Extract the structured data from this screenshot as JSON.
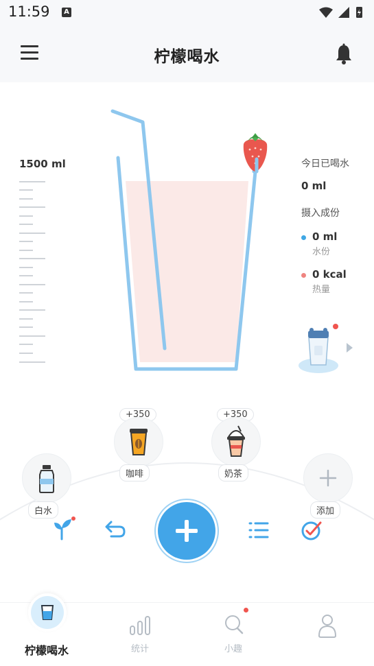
{
  "status_bar": {
    "time": "11:59"
  },
  "header": {
    "title": "柠檬喝水"
  },
  "goal": {
    "label": "1500 ml"
  },
  "today": {
    "title": "今日已喝水",
    "value": "0 ml",
    "intake_title": "摄入成份",
    "water_value": "0 ml",
    "water_label": "水份",
    "calorie_value": "0 kcal",
    "calorie_label": "热量"
  },
  "drinks": [
    {
      "label": "白水",
      "bonus": ""
    },
    {
      "label": "咖啡",
      "bonus": "+350"
    },
    {
      "label": "奶茶",
      "bonus": "+350"
    },
    {
      "label": "添加",
      "bonus": ""
    }
  ],
  "nav": [
    {
      "label": "柠檬喝水"
    },
    {
      "label": "统计"
    },
    {
      "label": "小趣"
    },
    {
      "label": ""
    }
  ],
  "colors": {
    "accent": "#42a5e8",
    "glass_outline": "#8ec7ee",
    "water_fill": "#fbe9e7",
    "water_dot": "#3fa7e4",
    "calorie_dot": "#ef8480",
    "notify_dot": "#f0554f"
  },
  "icons": [
    "menu-icon",
    "bell-icon",
    "strawberry-icon",
    "bottle-icon",
    "coffee-icon",
    "milk-tea-icon",
    "plus-icon",
    "sprout-icon",
    "undo-icon",
    "list-icon",
    "check-icon",
    "glass-icon",
    "chart-icon",
    "search-icon",
    "user-icon"
  ]
}
